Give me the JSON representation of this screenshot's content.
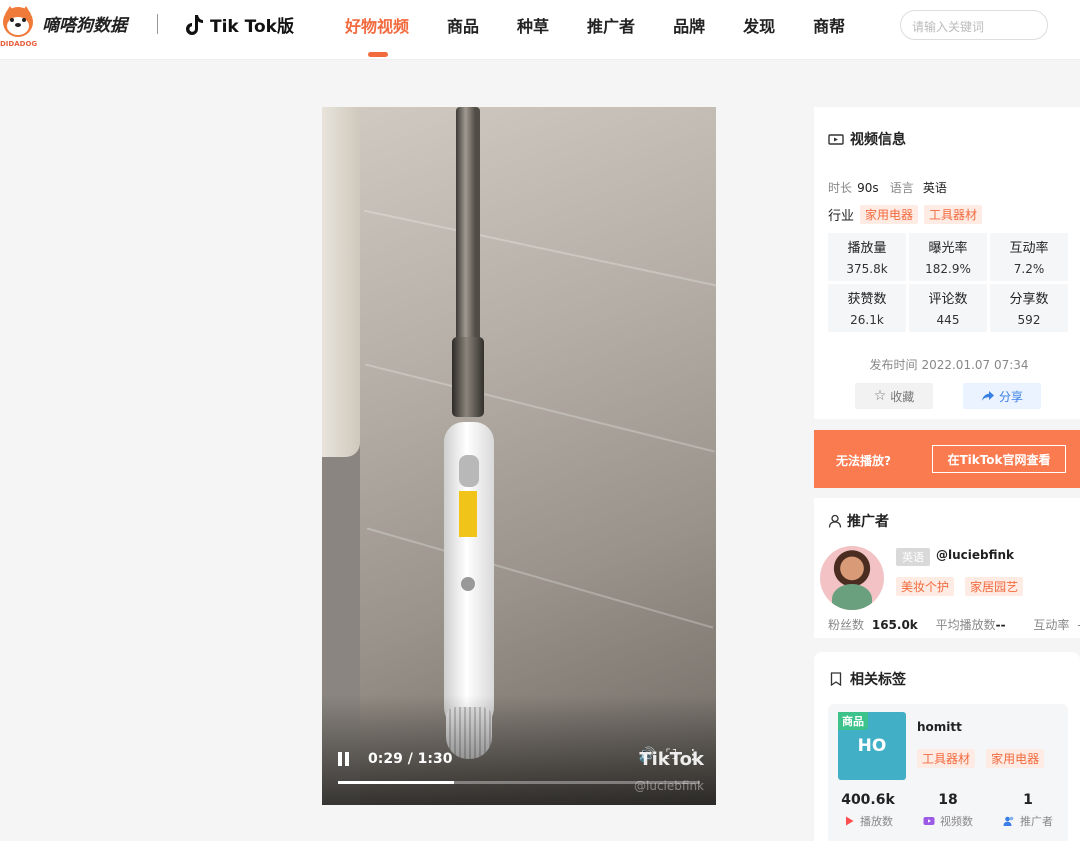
{
  "header": {
    "logo_text": "嘀嗒狗数据",
    "logo_sub": "DIDADOG",
    "tiktok_label": "Tik Tok版",
    "nav": [
      {
        "label": "好物视频",
        "active": true
      },
      {
        "label": "商品"
      },
      {
        "label": "种草"
      },
      {
        "label": "推广者"
      },
      {
        "label": "品牌"
      },
      {
        "label": "发现"
      },
      {
        "label": "商帮"
      }
    ],
    "search_placeholder": "请输入关键词"
  },
  "video": {
    "current_time": "0:29",
    "duration": "1:30",
    "time_display": "0:29 / 1:30",
    "progress": 0.32,
    "watermark": "TikTok",
    "watermark_user": "@luciebfink"
  },
  "info": {
    "title": "视频信息",
    "duration_label": "时长",
    "duration_value": "90s",
    "language_label": "语言",
    "language_value": "英语",
    "industry_label": "行业",
    "industry_tags": [
      "家用电器",
      "工具器材"
    ],
    "stats": [
      {
        "label": "播放量",
        "value": "375.8k"
      },
      {
        "label": "曝光率",
        "value": "182.9%"
      },
      {
        "label": "互动率",
        "value": "7.2%"
      },
      {
        "label": "获赞数",
        "value": "26.1k"
      },
      {
        "label": "评论数",
        "value": "445"
      },
      {
        "label": "分享数",
        "value": "592"
      }
    ],
    "publish_label": "发布时间",
    "publish_time": "2022.01.07 07:34",
    "favorite_label": "收藏",
    "share_label": "分享"
  },
  "cannot_play": {
    "question": "无法播放?",
    "button": "在TikTok官网查看"
  },
  "promoter": {
    "title": "推广者",
    "language": "英语",
    "name": "@luciebfink",
    "tags": [
      "美妆个护",
      "家居园艺"
    ],
    "fans_label": "粉丝数",
    "fans_value": "165.0k",
    "avg_play_label": "平均播放数",
    "avg_play_value": "--",
    "interaction_label": "互动率",
    "interaction_value": "--"
  },
  "related": {
    "title": "相关标签",
    "badge": "商品",
    "thumb_text": "HO",
    "name": "homitt",
    "tags": [
      "工具器材",
      "家用电器"
    ],
    "nums": [
      {
        "value": "400.6k",
        "label": "播放数",
        "icon": "play-icon",
        "color": "#ff4d4f"
      },
      {
        "value": "18",
        "label": "视频数",
        "icon": "video-icon",
        "color": "#9b59e6"
      },
      {
        "value": "1",
        "label": "推广者",
        "icon": "users-icon",
        "color": "#3a7fe5"
      }
    ]
  },
  "colors": {
    "accent": "#f26a3d",
    "orange_banner": "#fb7b50",
    "share_blue": "#3a7fe5"
  }
}
